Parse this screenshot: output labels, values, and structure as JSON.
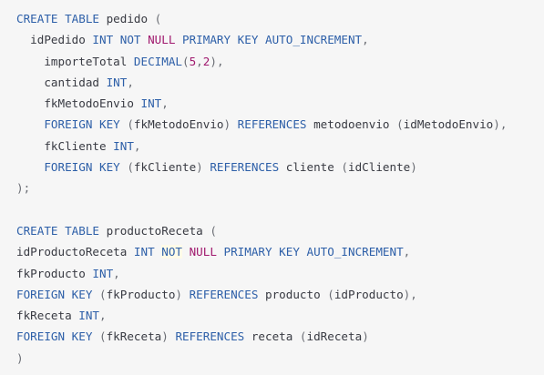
{
  "colors": {
    "background": "#f6f6f6",
    "keyword": "#2d5fa8",
    "null_keyword": "#a0196e",
    "number": "#a0196e",
    "punctuation": "#696c73",
    "identifier": "#383a42"
  },
  "code": {
    "lines": [
      [
        [
          "kw",
          "CREATE TABLE "
        ],
        [
          "plain",
          "pedido "
        ],
        [
          "punc",
          "("
        ]
      ],
      [
        [
          "plain",
          "  idPedido "
        ],
        [
          "kw",
          "INT NOT "
        ],
        [
          "null",
          "NULL"
        ],
        [
          "kw",
          " PRIMARY KEY AUTO_INCREMENT"
        ],
        [
          "punc",
          ","
        ]
      ],
      [
        [
          "plain",
          "    importeTotal "
        ],
        [
          "kw",
          "DECIMAL"
        ],
        [
          "punc",
          "("
        ],
        [
          "num",
          "5"
        ],
        [
          "punc",
          ","
        ],
        [
          "num",
          "2"
        ],
        [
          "punc",
          "),"
        ]
      ],
      [
        [
          "plain",
          "    cantidad "
        ],
        [
          "kw",
          "INT"
        ],
        [
          "punc",
          ","
        ]
      ],
      [
        [
          "plain",
          "    fkMetodoEnvio "
        ],
        [
          "kw",
          "INT"
        ],
        [
          "punc",
          ","
        ]
      ],
      [
        [
          "kw",
          "    FOREIGN KEY "
        ],
        [
          "punc",
          "("
        ],
        [
          "plain",
          "fkMetodoEnvio"
        ],
        [
          "punc",
          ") "
        ],
        [
          "kw",
          "REFERENCES "
        ],
        [
          "plain",
          "metodoenvio "
        ],
        [
          "punc",
          "("
        ],
        [
          "plain",
          "idMetodoEnvio"
        ],
        [
          "punc",
          "),"
        ]
      ],
      [
        [
          "plain",
          "    fkCliente "
        ],
        [
          "kw",
          "INT"
        ],
        [
          "punc",
          ","
        ]
      ],
      [
        [
          "kw",
          "    FOREIGN KEY "
        ],
        [
          "punc",
          "("
        ],
        [
          "plain",
          "fkCliente"
        ],
        [
          "punc",
          ") "
        ],
        [
          "kw",
          "REFERENCES "
        ],
        [
          "plain",
          "cliente "
        ],
        [
          "punc",
          "("
        ],
        [
          "plain",
          "idCliente"
        ],
        [
          "punc",
          ")"
        ]
      ],
      [
        [
          "punc",
          ");"
        ]
      ],
      [
        [
          "plain",
          ""
        ]
      ],
      [
        [
          "kw",
          "CREATE TABLE "
        ],
        [
          "plain",
          "productoReceta "
        ],
        [
          "punc",
          "("
        ]
      ],
      [
        [
          "plain",
          "idProductoReceta "
        ],
        [
          "kw",
          "INT "
        ],
        [
          "hl",
          "NOT"
        ],
        [
          "plain",
          " "
        ],
        [
          "null",
          "NULL"
        ],
        [
          "kw",
          " PRIMARY KEY AUTO_INCREMENT"
        ],
        [
          "punc",
          ","
        ]
      ],
      [
        [
          "plain",
          "fkProducto "
        ],
        [
          "kw",
          "INT"
        ],
        [
          "punc",
          ","
        ]
      ],
      [
        [
          "kw",
          "FOREIGN KEY "
        ],
        [
          "punc",
          "("
        ],
        [
          "plain",
          "fkProducto"
        ],
        [
          "punc",
          ") "
        ],
        [
          "kw",
          "REFERENCES "
        ],
        [
          "plain",
          "producto "
        ],
        [
          "punc",
          "("
        ],
        [
          "plain",
          "idProducto"
        ],
        [
          "punc",
          "),"
        ]
      ],
      [
        [
          "plain",
          "fkReceta "
        ],
        [
          "kw",
          "INT"
        ],
        [
          "punc",
          ","
        ]
      ],
      [
        [
          "kw",
          "FOREIGN KEY "
        ],
        [
          "punc",
          "("
        ],
        [
          "plain",
          "fkReceta"
        ],
        [
          "punc",
          ") "
        ],
        [
          "kw",
          "REFERENCES "
        ],
        [
          "plain",
          "receta "
        ],
        [
          "punc",
          "("
        ],
        [
          "plain",
          "idReceta"
        ],
        [
          "punc",
          ")"
        ]
      ],
      [
        [
          "punc",
          ")"
        ]
      ]
    ]
  }
}
